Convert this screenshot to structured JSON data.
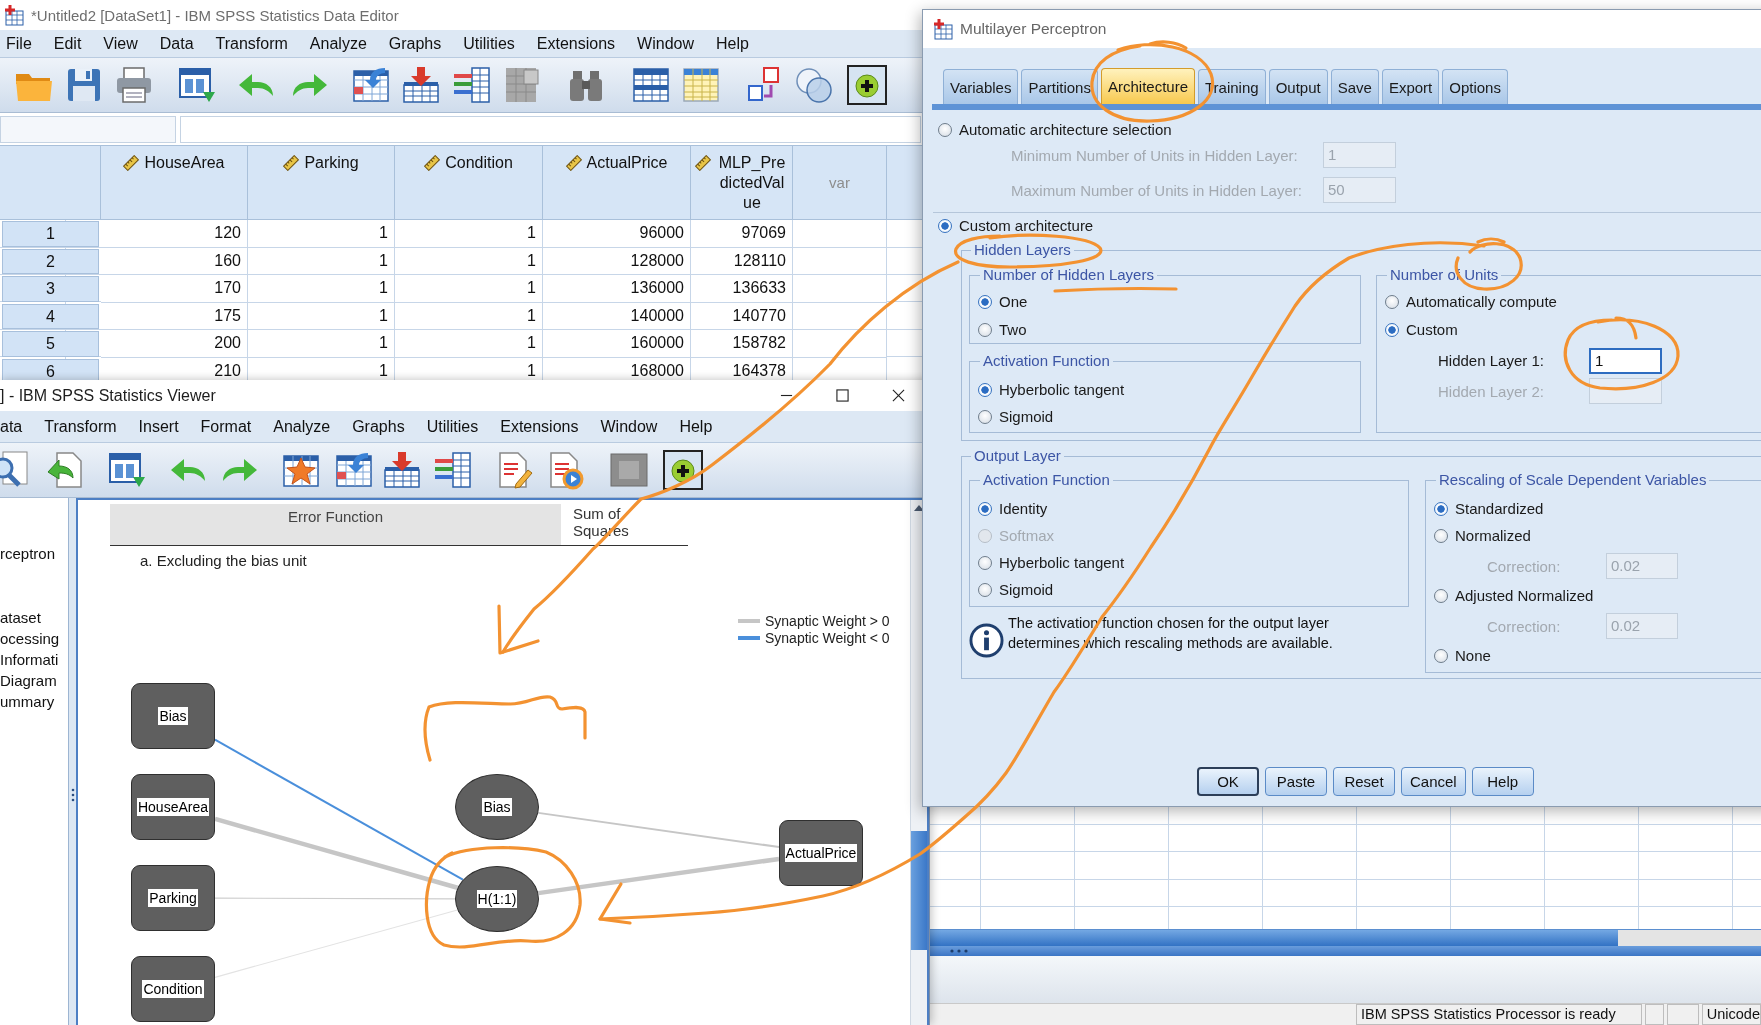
{
  "data_editor": {
    "title": "*Untitled2 [DataSet1] - IBM SPSS Statistics Data Editor",
    "menu": [
      "File",
      "Edit",
      "View",
      "Data",
      "Transform",
      "Analyze",
      "Graphs",
      "Utilities",
      "Extensions",
      "Window",
      "Help"
    ],
    "columns": [
      {
        "name": "HouseArea",
        "kind": "scale"
      },
      {
        "name": "Parking",
        "kind": "scale"
      },
      {
        "name": "Condition",
        "kind": "scale"
      },
      {
        "name": "ActualPrice",
        "kind": "scale"
      },
      {
        "name": "MLP_PredictedValue",
        "kind": "scale"
      },
      {
        "name": "var",
        "kind": "empty"
      }
    ],
    "rows": [
      {
        "case": "1",
        "cells": [
          "120",
          "1",
          "1",
          "96000",
          "97069"
        ]
      },
      {
        "case": "2",
        "cells": [
          "160",
          "1",
          "1",
          "128000",
          "128110"
        ]
      },
      {
        "case": "3",
        "cells": [
          "170",
          "1",
          "1",
          "136000",
          "136633"
        ]
      },
      {
        "case": "4",
        "cells": [
          "175",
          "1",
          "1",
          "140000",
          "140770"
        ]
      },
      {
        "case": "5",
        "cells": [
          "200",
          "1",
          "1",
          "160000",
          "158782"
        ]
      },
      {
        "case": "6",
        "cells": [
          "210",
          "1",
          "1",
          "168000",
          "164378"
        ]
      }
    ],
    "status_bar": {
      "message": "IBM SPSS Statistics Processor is ready",
      "encoding": "Unicode"
    }
  },
  "viewer": {
    "title": "] - IBM SPSS Statistics Viewer",
    "menu": [
      "ata",
      "Transform",
      "Insert",
      "Format",
      "Analyze",
      "Graphs",
      "Utilities",
      "Extensions",
      "Window",
      "Help"
    ],
    "outline": [
      "rceptron",
      "ataset",
      "ocessing",
      "Informati",
      "Diagram",
      "ummary"
    ],
    "table": {
      "row_header": "Error Function",
      "value": "Sum of Squares",
      "footnote": "a. Excluding the bias unit"
    },
    "legend": [
      {
        "label": "Synaptic Weight > 0",
        "color": "#c6c6c6"
      },
      {
        "label": "Synaptic Weight < 0",
        "color": "#4a8fdb"
      }
    ],
    "network": {
      "input_layer": [
        {
          "label": "Bias",
          "link": {
            "kind": "medium",
            "color": "#4a8fdb"
          }
        },
        {
          "label": "HouseArea",
          "link": {
            "kind": "thick",
            "color": "#c6c6c6"
          }
        },
        {
          "label": "Parking",
          "link": {
            "kind": "thin",
            "color": "#cdcdcd"
          }
        },
        {
          "label": "Condition",
          "link": {
            "kind": "thin",
            "color": "#e3e3e3"
          }
        }
      ],
      "hidden_layer": [
        {
          "label": "Bias",
          "kind": "bias",
          "link": {
            "kind": "medium",
            "color": "#c6c6c6"
          }
        },
        {
          "label": "H(1:1)",
          "kind": "unit",
          "link": {
            "kind": "thick",
            "color": "#c6c6c6"
          }
        }
      ],
      "output_layer": [
        {
          "label": "ActualPrice"
        }
      ]
    }
  },
  "dialog": {
    "title": "Multilayer Perceptron",
    "tabs": [
      {
        "label": "Variables",
        "selected": false
      },
      {
        "label": "Partitions",
        "selected": false
      },
      {
        "label": "Architecture",
        "selected": true
      },
      {
        "label": "Training",
        "selected": false
      },
      {
        "label": "Output",
        "selected": false
      },
      {
        "label": "Save",
        "selected": false
      },
      {
        "label": "Export",
        "selected": false
      },
      {
        "label": "Options",
        "selected": false
      }
    ],
    "architecture": [
      {
        "label": "Automatic architecture selection",
        "selected": false,
        "fields": [
          {
            "label": "Minimum Number of Units in Hidden Layer:",
            "value": "1",
            "disabled": true
          },
          {
            "label": "Maximum Number of Units in Hidden Layer:",
            "value": "50",
            "disabled": true
          }
        ]
      },
      {
        "label": "Custom architecture",
        "selected": true
      }
    ],
    "hidden_layers": {
      "title": "Hidden Layers",
      "count": {
        "title": "Number of Hidden Layers",
        "options": [
          {
            "label": "One",
            "selected": true
          },
          {
            "label": "Two",
            "selected": false
          }
        ]
      },
      "activation": {
        "title": "Activation Function",
        "options": [
          {
            "label": "Hyberbolic tangent",
            "selected": true
          },
          {
            "label": "Sigmoid",
            "selected": false
          }
        ]
      },
      "units": {
        "title": "Number of Units",
        "options": [
          {
            "label": "Automatically compute",
            "selected": false
          },
          {
            "label": "Custom",
            "selected": true
          }
        ],
        "fields": [
          {
            "label": "Hidden Layer 1:",
            "value": "1",
            "disabled": false
          },
          {
            "label": "Hidden Layer 2:",
            "disabled": true
          }
        ]
      }
    },
    "output_layer": {
      "title": "Output Layer",
      "activation": {
        "title": "Activation Function",
        "options": [
          {
            "label": "Identity",
            "selected": true,
            "disabled": false
          },
          {
            "label": "Softmax",
            "selected": false,
            "disabled": true
          },
          {
            "label": "Hyberbolic tangent",
            "selected": false,
            "disabled": false
          },
          {
            "label": "Sigmoid",
            "selected": false,
            "disabled": false
          }
        ]
      },
      "note": "The activation function chosen for the output layer determines which rescaling methods are available.",
      "rescaling": {
        "title": "Rescaling of Scale Dependent Variables",
        "options": [
          {
            "label": "Standardized",
            "selected": true
          },
          {
            "label": "Normalized",
            "selected": false,
            "correction": {
              "label": "Correction:",
              "value": "0.02",
              "disabled": true
            }
          },
          {
            "label": "Adjusted Normalized",
            "selected": false,
            "correction": {
              "label": "Correction:",
              "value": "0.02",
              "disabled": true
            }
          },
          {
            "label": "None",
            "selected": false
          }
        ]
      }
    },
    "buttons": [
      {
        "label": "OK",
        "default": true
      },
      {
        "label": "Paste",
        "default": false
      },
      {
        "label": "Reset",
        "default": false
      },
      {
        "label": "Cancel",
        "default": false
      },
      {
        "label": "Help",
        "default": false
      }
    ]
  }
}
